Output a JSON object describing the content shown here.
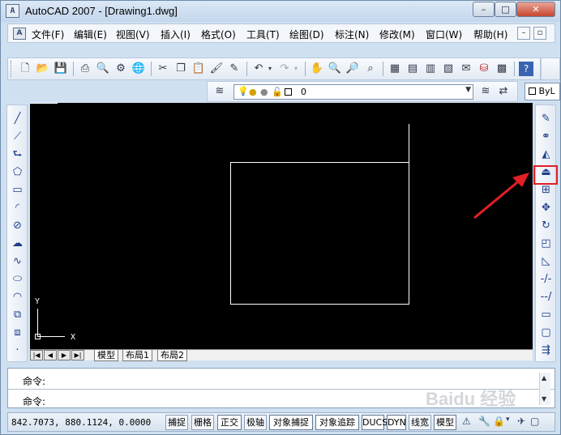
{
  "window": {
    "title": "AutoCAD 2007 - [Drawing1.dwg]",
    "app_icon": "autocad-logo-icon"
  },
  "title_buttons": {
    "minimize": "–",
    "maximize": "□",
    "close": "✕"
  },
  "menu": {
    "items": [
      "文件(F)",
      "编辑(E)",
      "视图(V)",
      "插入(I)",
      "格式(O)",
      "工具(T)",
      "绘图(D)",
      "标注(N)",
      "修改(M)",
      "窗口(W)",
      "帮助(H)"
    ],
    "doc_min": "–",
    "doc_restore": "▫"
  },
  "layer": {
    "current": "0",
    "linetype_box": "ByL"
  },
  "canvas": {
    "ucs_y_label": "Y",
    "ucs_x_label": "X"
  },
  "tabs": {
    "nav": [
      "|◀",
      "◀",
      "▶",
      "▶|"
    ],
    "items": [
      "模型",
      "布局1",
      "布局2"
    ],
    "active": 0
  },
  "command": {
    "line1": "命令:",
    "line2": "命令:",
    "scroll_up": "▲",
    "scroll_down": "▼"
  },
  "watermark": "Baidu 经验",
  "status": {
    "coords": "842.7073,  880.1124, 0.0000",
    "buttons": [
      "捕捉",
      "栅格",
      "正交",
      "极轴",
      "对象捕捉",
      "对象追踪",
      "DUCS",
      "DYN",
      "线宽",
      "模型"
    ],
    "active_buttons": [
      "正交",
      "对象捕捉",
      "对象追踪",
      "DUCS",
      "DYN",
      "模型"
    ]
  },
  "colors": {
    "canvas_bg": "#000000",
    "highlight": "#e21f26",
    "chrome": "#cfe0f1"
  }
}
